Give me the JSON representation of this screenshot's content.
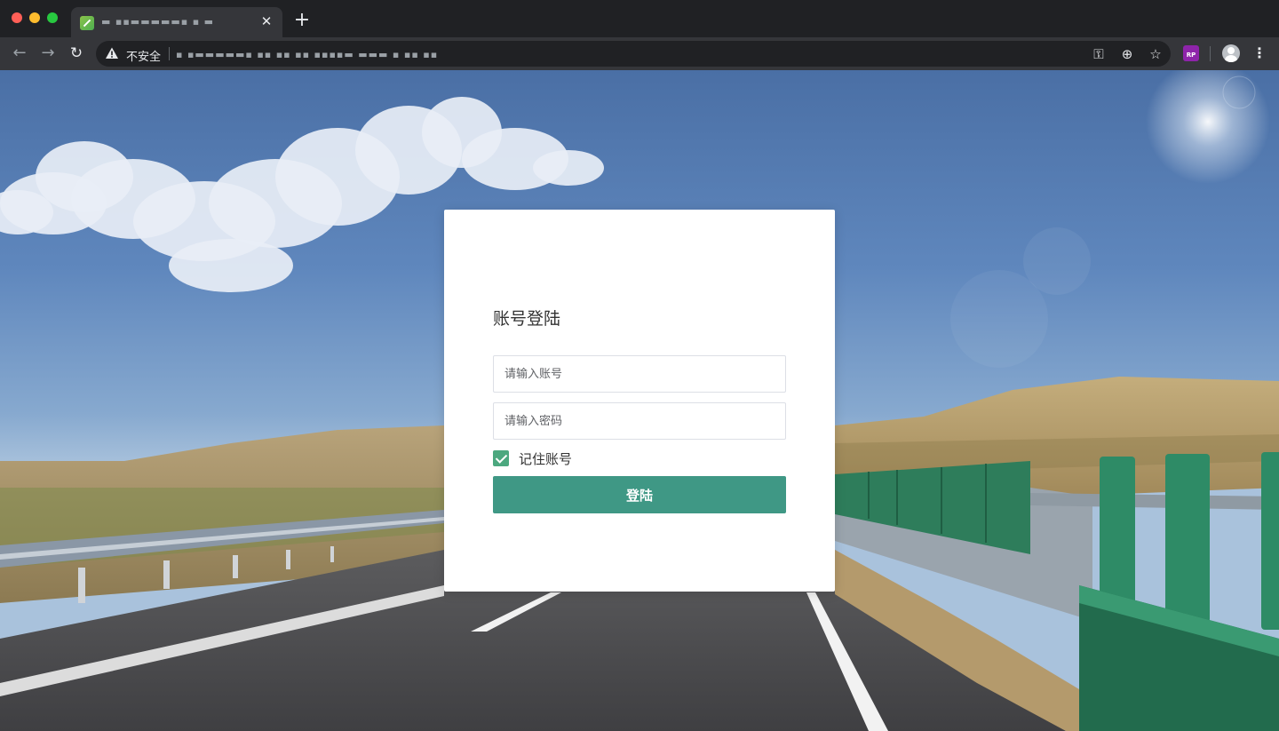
{
  "browser": {
    "tab": {
      "title": "▬ ▪▪▬▬▬▬▬▪ ▪ ▬",
      "favicon": "green-leaf-icon",
      "close_icon": "✕"
    },
    "new_tab_icon": "+",
    "nav": {
      "back": "←",
      "forward": "→",
      "reload": "↻"
    },
    "omnibox": {
      "security_label": "不安全",
      "url": "▪ ▪▬▬▬▬▬▪ ▪▪ ▪▪ ▪▪  ▪▪▪▪▬ ▬▬▬ ▪ ▪▪ ▪▪"
    },
    "icons": {
      "key": "⚿",
      "zoom": "⊕",
      "star": "☆",
      "extension": "RP",
      "menu": "⋮"
    }
  },
  "login": {
    "title": "账号登陆",
    "account_placeholder": "请输入账号",
    "password_placeholder": "请输入密码",
    "remember_label": "记住账号",
    "remember_checked": true,
    "submit_label": "登陆"
  },
  "colors": {
    "primary_button": "#3f9885",
    "checkbox": "#4ca87f",
    "chrome_dark": "#202124",
    "chrome_toolbar": "#35363a"
  }
}
